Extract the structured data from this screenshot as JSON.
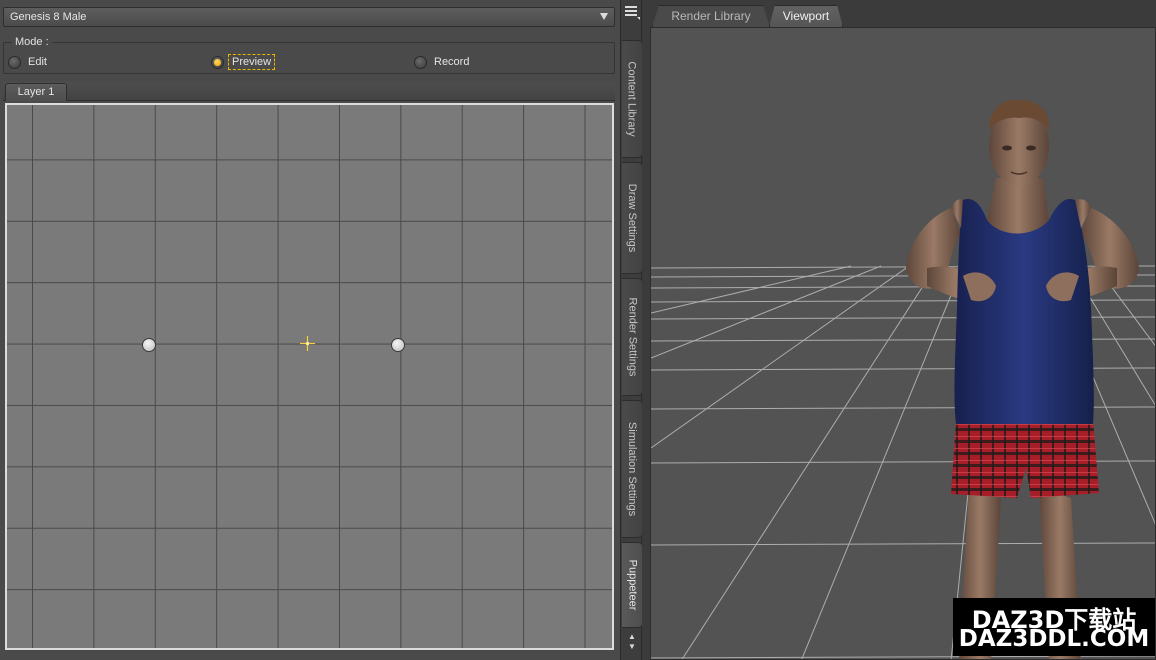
{
  "figure_select": {
    "value": "Genesis 8 Male"
  },
  "mode": {
    "legend": "Mode :",
    "options": [
      {
        "label": "Edit",
        "selected": false
      },
      {
        "label": "Preview",
        "selected": true
      },
      {
        "label": "Record",
        "selected": false
      }
    ]
  },
  "layers": {
    "tabs": [
      "Layer 1"
    ]
  },
  "side_tabs": [
    "Content Library",
    "Draw Settings",
    "Render Settings",
    "Simulation Settings",
    "Puppeteer"
  ],
  "viewport_tabs": [
    "Render Library",
    "Viewport"
  ],
  "watermark": {
    "line1": "DAZ3D下载站",
    "line2": "DAZ3DDL.COM"
  },
  "colors": {
    "accent": "#f0b000",
    "grid_bg": "#7a7a7a",
    "viewport_bg": "#535353",
    "shirt": "#1f2c6a",
    "shorts": "#b0202a"
  }
}
